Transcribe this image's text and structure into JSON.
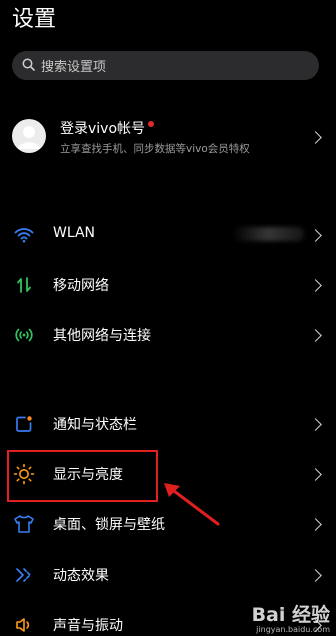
{
  "header": {
    "title": "设置"
  },
  "search": {
    "placeholder": "搜索设置项",
    "icon": "search-icon"
  },
  "account": {
    "name": "登录vivo帐号",
    "subtitle": "立享查找手机、同步数据等vivo会员特权",
    "notification_dot_color": "#e22a2a"
  },
  "groups": {
    "network": [
      {
        "label": "WLAN",
        "icon": "wifi-icon",
        "value_obscured": true
      },
      {
        "label": "移动网络",
        "icon": "mobile-network-icon"
      },
      {
        "label": "其他网络与连接",
        "icon": "connection-icon"
      }
    ],
    "system": [
      {
        "label": "通知与状态栏",
        "icon": "notification-icon"
      },
      {
        "label": "显示与亮度",
        "icon": "brightness-icon"
      },
      {
        "label": "桌面、锁屏与壁纸",
        "icon": "wallpaper-icon"
      },
      {
        "label": "动态效果",
        "icon": "animation-icon"
      },
      {
        "label": "声音与振动",
        "icon": "sound-icon"
      }
    ]
  },
  "annotation": {
    "highlight_color": "#e0201f",
    "target": "显示与亮度"
  },
  "watermark": {
    "main": "Bai 经验",
    "sub": "jingyan.baidu.com"
  }
}
